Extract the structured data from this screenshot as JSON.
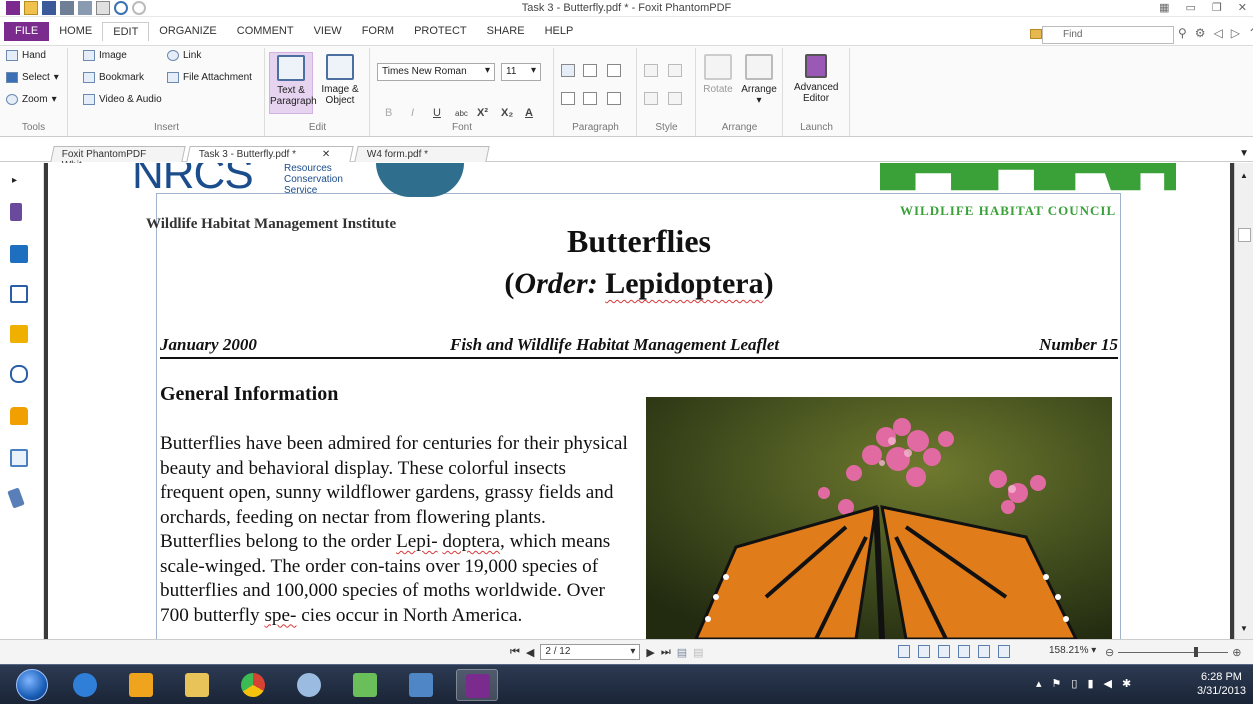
{
  "window": {
    "title": "Task 3 - Butterfly.pdf * - Foxit PhantomPDF"
  },
  "menu": {
    "tabs": [
      "FILE",
      "HOME",
      "EDIT",
      "ORGANIZE",
      "COMMENT",
      "VIEW",
      "FORM",
      "PROTECT",
      "SHARE",
      "HELP"
    ],
    "find_placeholder": "Find"
  },
  "ribbon": {
    "tools": {
      "hand": "Hand",
      "select": "Select",
      "zoom": "Zoom",
      "label": "Tools"
    },
    "insert": {
      "image": "Image",
      "bookmark": "Bookmark",
      "video": "Video & Audio",
      "link": "Link",
      "file_attachment": "File Attachment",
      "label": "Insert"
    },
    "edit": {
      "text_paragraph_1": "Text &",
      "text_paragraph_2": "Paragraph",
      "image_object_1": "Image &",
      "image_object_2": "Object",
      "label": "Edit"
    },
    "font": {
      "family": "Times New Roman",
      "size": "11",
      "label": "Font"
    },
    "paragraph": {
      "label": "Paragraph"
    },
    "style": {
      "label": "Style"
    },
    "arrange": {
      "rotate": "Rotate",
      "arrange": "Arrange",
      "label": "Arrange"
    },
    "launch": {
      "advanced_1": "Advanced",
      "advanced_2": "Editor",
      "label": "Launch"
    }
  },
  "doc_tabs": [
    {
      "label": "Foxit PhantomPDF Whit..."
    },
    {
      "label": "Task 3 - Butterfly.pdf *"
    },
    {
      "label": "W4 form.pdf *"
    }
  ],
  "document": {
    "nrcs_text": "NRCS",
    "nrcs_sub_1": "Resources",
    "nrcs_sub_2": "Conservation",
    "nrcs_sub_3": "Service",
    "wmi": "Wildlife Habitat Management Institute",
    "whc": "WILDLIFE HABITAT COUNCIL",
    "title": "Butterflies",
    "subtitle_open": "(",
    "subtitle_order": "Order:",
    "subtitle_name": "Lepidoptera",
    "subtitle_close": ")",
    "date": "January 2000",
    "leaflet": "Fish and Wildlife Habitat Management Leaflet",
    "number": "Number 15",
    "section_heading": "General Information",
    "paragraph_part1": "Butterflies have been admired for centuries for their physical beauty and behavioral display. These colorful insects frequent open, sunny wildflower gardens, grassy fields and orchards, feeding on nectar from flowering plants.  Butterflies belong to the order ",
    "paragraph_lepi": "Lepi-",
    "paragraph_doptera": "doptera",
    "paragraph_part2": ", which means scale-winged.  The order con-tains over 19,000 species of butterflies and 100,000 species of moths worldwide.  Over 700 butterfly ",
    "paragraph_spe": "spe-",
    "paragraph_part3": "cies occur in North America."
  },
  "statusbar": {
    "page": "2 / 12",
    "zoom": "158.21%"
  },
  "taskbar": {
    "time": "6:28 PM",
    "date": "3/31/2013"
  }
}
